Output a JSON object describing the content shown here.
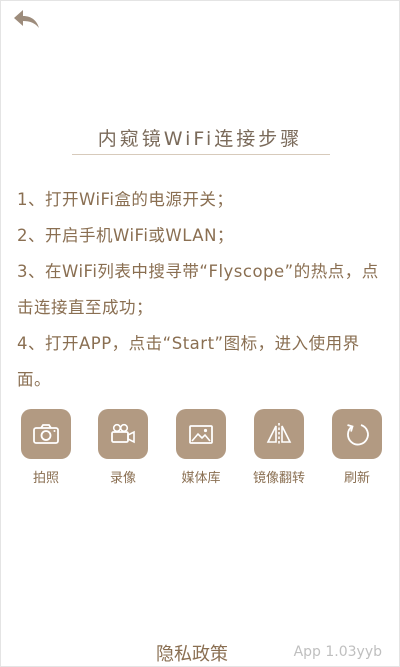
{
  "header": {
    "back_icon": "back-arrow-icon"
  },
  "title": "内窥镜WiFi连接步骤",
  "instructions": [
    "1、打开WiFi盒的电源开关；",
    "2、开启手机WiFi或WLAN；",
    "3、在WiFi列表中搜寻带“Flyscope”的热点，点击连接直至成功；",
    "4、打开APP，点击“Start”图标，进入使用界面。"
  ],
  "buttons": [
    {
      "label": "拍照",
      "icon": "camera-icon"
    },
    {
      "label": "录像",
      "icon": "video-camera-icon"
    },
    {
      "label": "媒体库",
      "icon": "gallery-icon"
    },
    {
      "label": "镜像翻转",
      "icon": "mirror-flip-icon"
    },
    {
      "label": "刷新",
      "icon": "refresh-icon"
    }
  ],
  "footer": {
    "privacy": "隐私政策",
    "version": "App 1.03yyb"
  },
  "colors": {
    "accent": "#b29a82",
    "text": "#8a6f52",
    "title": "#7a6a5a",
    "back_icon": "#9d8c7c"
  }
}
